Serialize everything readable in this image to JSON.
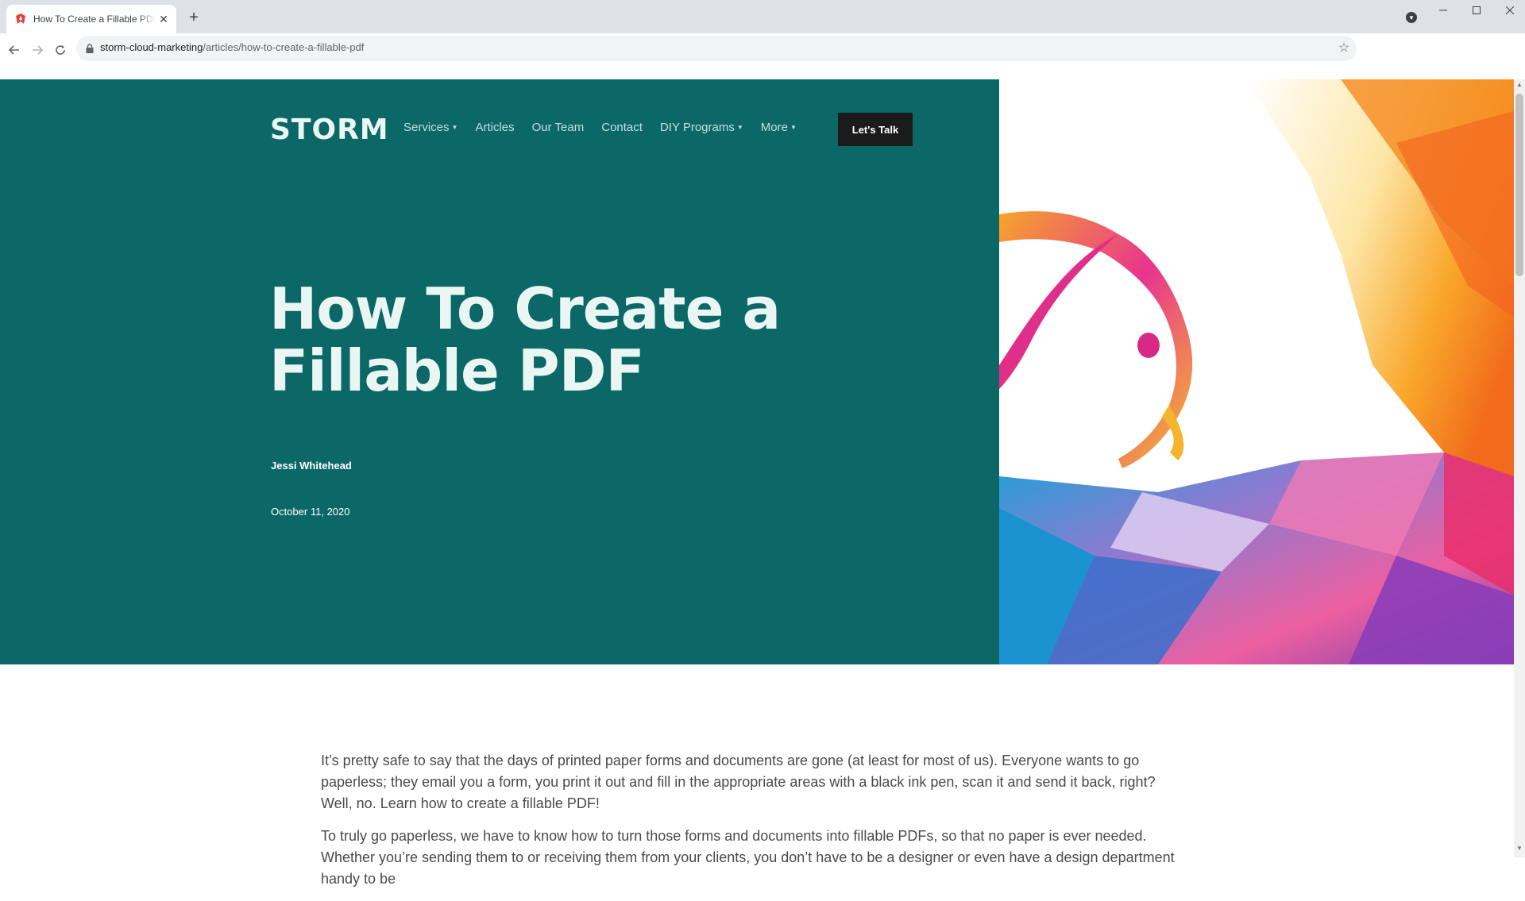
{
  "browser": {
    "tab_title": "How To Create a Fillable PDF - Storm Cloud Marketing",
    "url_host": "storm-cloud-marketing",
    "url_path": "/articles/how-to-create-a-fillable-pdf",
    "new_tab_glyph": "+",
    "close_glyph": "✕"
  },
  "site": {
    "logo": "STORM",
    "nav": [
      {
        "label": "Services",
        "has_dropdown": true
      },
      {
        "label": "Articles",
        "has_dropdown": false
      },
      {
        "label": "Our Team",
        "has_dropdown": false
      },
      {
        "label": "Contact",
        "has_dropdown": false
      },
      {
        "label": "DIY Programs",
        "has_dropdown": true
      },
      {
        "label": "More",
        "has_dropdown": true
      }
    ],
    "cta_label": "Let's Talk"
  },
  "article": {
    "title": "How To Create a Fillable PDF",
    "author": "Jessi Whitehead",
    "date": "October 11, 2020",
    "paragraphs": [
      "It’s pretty safe to say that the days of printed paper forms and documents are gone (at least for most of us). Everyone wants to go paperless; they email you a form, you print it out and fill in the appropriate areas with a black ink pen, scan it and send it back, right? Well, no. Learn how to create a fillable PDF!",
      "To truly go paperless, we have to know how to turn those forms and documents into fillable PDFs, so that no paper is ever needed. Whether you’re sending them to or receiving them from your clients, you don’t have to be a designer or even have a design department handy to be"
    ]
  },
  "colors": {
    "hero_bg": "#0b6866",
    "hero_text": "#e9f6f4",
    "cta_bg": "#1b1b1b",
    "brand_accent": "#e5433a"
  },
  "icons": [
    "storm-favicon",
    "back-arrow-icon",
    "forward-arrow-icon",
    "reload-icon",
    "lock-icon",
    "bookmark-star-icon",
    "profile-icon",
    "minimize-icon",
    "maximize-icon",
    "close-window-icon",
    "caret-down-icon"
  ]
}
